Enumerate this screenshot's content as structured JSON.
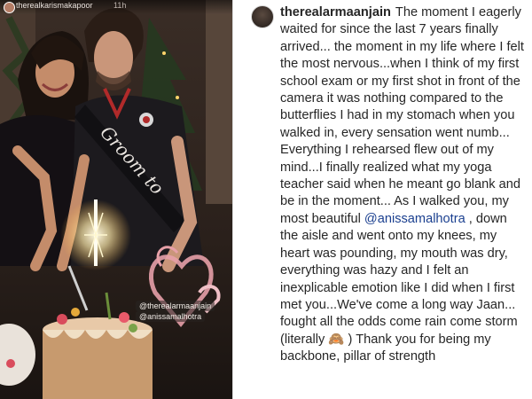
{
  "story": {
    "username": "therealkarismakapoor",
    "time": "11h",
    "mentions": [
      "@therealarmaanjain",
      "@anissamalhotra"
    ]
  },
  "post": {
    "username": "therealarmaanjain",
    "caption_part1": "The moment I eagerly waited for since the last 7 years finally arrived... the moment in my life where I felt the most nervous...when I think of my first school exam or my first shot in front of the camera it was nothing compared to the butterflies I had in my stomach when you walked in, every sensation went numb... Everything I rehearsed flew out of my mind...I finally realized what my yoga teacher said when he meant go blank and be in the moment... As I walked you, my most beautiful ",
    "mention": "@anissamalhotra",
    "caption_part2": " , down the aisle and went onto my knees, my heart was pounding, my mouth was dry, everything was hazy and I felt an inexplicable emotion like I did when I first met you...We've come a long way Jaan... fought all the odds come rain come storm (literally 🙈 ) Thank you for being my backbone, pillar of strength"
  },
  "colors": {
    "text": "#262626",
    "link": "#1a3f8f",
    "story_bg": "#1a1411"
  }
}
